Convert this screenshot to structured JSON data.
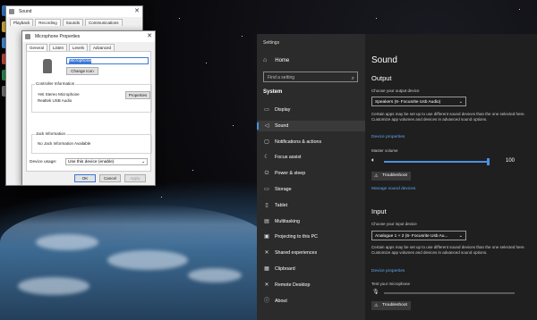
{
  "desktop": {
    "icon_colors": [
      "#3a77c9",
      "#d9b23a",
      "#4c8fe0",
      "#c94a3a",
      "#2f8f4f",
      "#777777"
    ]
  },
  "sound_dialog": {
    "title": "Sound",
    "tabs": [
      "Playback",
      "Recording",
      "Sounds",
      "Communications"
    ]
  },
  "mic_properties": {
    "title": "Microphone Properties",
    "tabs": [
      "General",
      "Listen",
      "Levels",
      "Advanced"
    ],
    "device_name": "Microphone",
    "change_icon_label": "Change Icon",
    "controller_group": "Controller Information",
    "controller_line1": "Yeti Stereo Microphone",
    "controller_line2": "Realtek USB Audio",
    "properties_label": "Properties",
    "jack_group": "Jack Information",
    "jack_text": "No Jack Information Available",
    "device_usage_label": "Device usage:",
    "device_usage_value": "Use this device (enable)",
    "ok_label": "OK",
    "cancel_label": "Cancel",
    "apply_label": "Apply"
  },
  "settings": {
    "window_title": "Settings",
    "home_label": "Home",
    "search_placeholder": "Find a setting",
    "section_label": "System",
    "nav_items": [
      {
        "icon": "display-icon",
        "label": "Display"
      },
      {
        "icon": "sound-icon",
        "label": "Sound"
      },
      {
        "icon": "notifications-icon",
        "label": "Notifications & actions"
      },
      {
        "icon": "focus-assist-icon",
        "label": "Focus assist"
      },
      {
        "icon": "power-icon",
        "label": "Power & sleep"
      },
      {
        "icon": "storage-icon",
        "label": "Storage"
      },
      {
        "icon": "tablet-icon",
        "label": "Tablet"
      },
      {
        "icon": "multitasking-icon",
        "label": "Multitasking"
      },
      {
        "icon": "projecting-icon",
        "label": "Projecting to this PC"
      },
      {
        "icon": "shared-experiences-icon",
        "label": "Shared experiences"
      },
      {
        "icon": "clipboard-icon",
        "label": "Clipboard"
      },
      {
        "icon": "remote-desktop-icon",
        "label": "Remote Desktop"
      },
      {
        "icon": "about-icon",
        "label": "About"
      }
    ],
    "active_nav": "Sound",
    "page_title": "Sound",
    "output": {
      "heading": "Output",
      "device_label": "Choose your output device",
      "device_value": "Speakers (6- Focusrite Usb Audio)",
      "note": "Certain apps may be set up to use different sound devices than the one selected here. Customize app volumes and devices in advanced sound options.",
      "device_properties_link": "Device properties",
      "master_volume_label": "Master volume",
      "master_volume_value": "100",
      "master_volume_fraction": 1.0,
      "troubleshoot_label": "Troubleshoot",
      "manage_devices_link": "Manage sound devices"
    },
    "input": {
      "heading": "Input",
      "device_label": "Choose your input device",
      "device_value": "Analogue 1 + 2 (6- Focusrite Usb Au...",
      "note": "Certain apps may be set up to use different sound devices than the one selected here. Customize app volumes and devices in advanced sound options.",
      "device_properties_link": "Device properties",
      "test_mic_label": "Test your microphone",
      "troubleshoot_label": "Troubleshoot"
    },
    "accent_color": "#4c8fe0"
  }
}
